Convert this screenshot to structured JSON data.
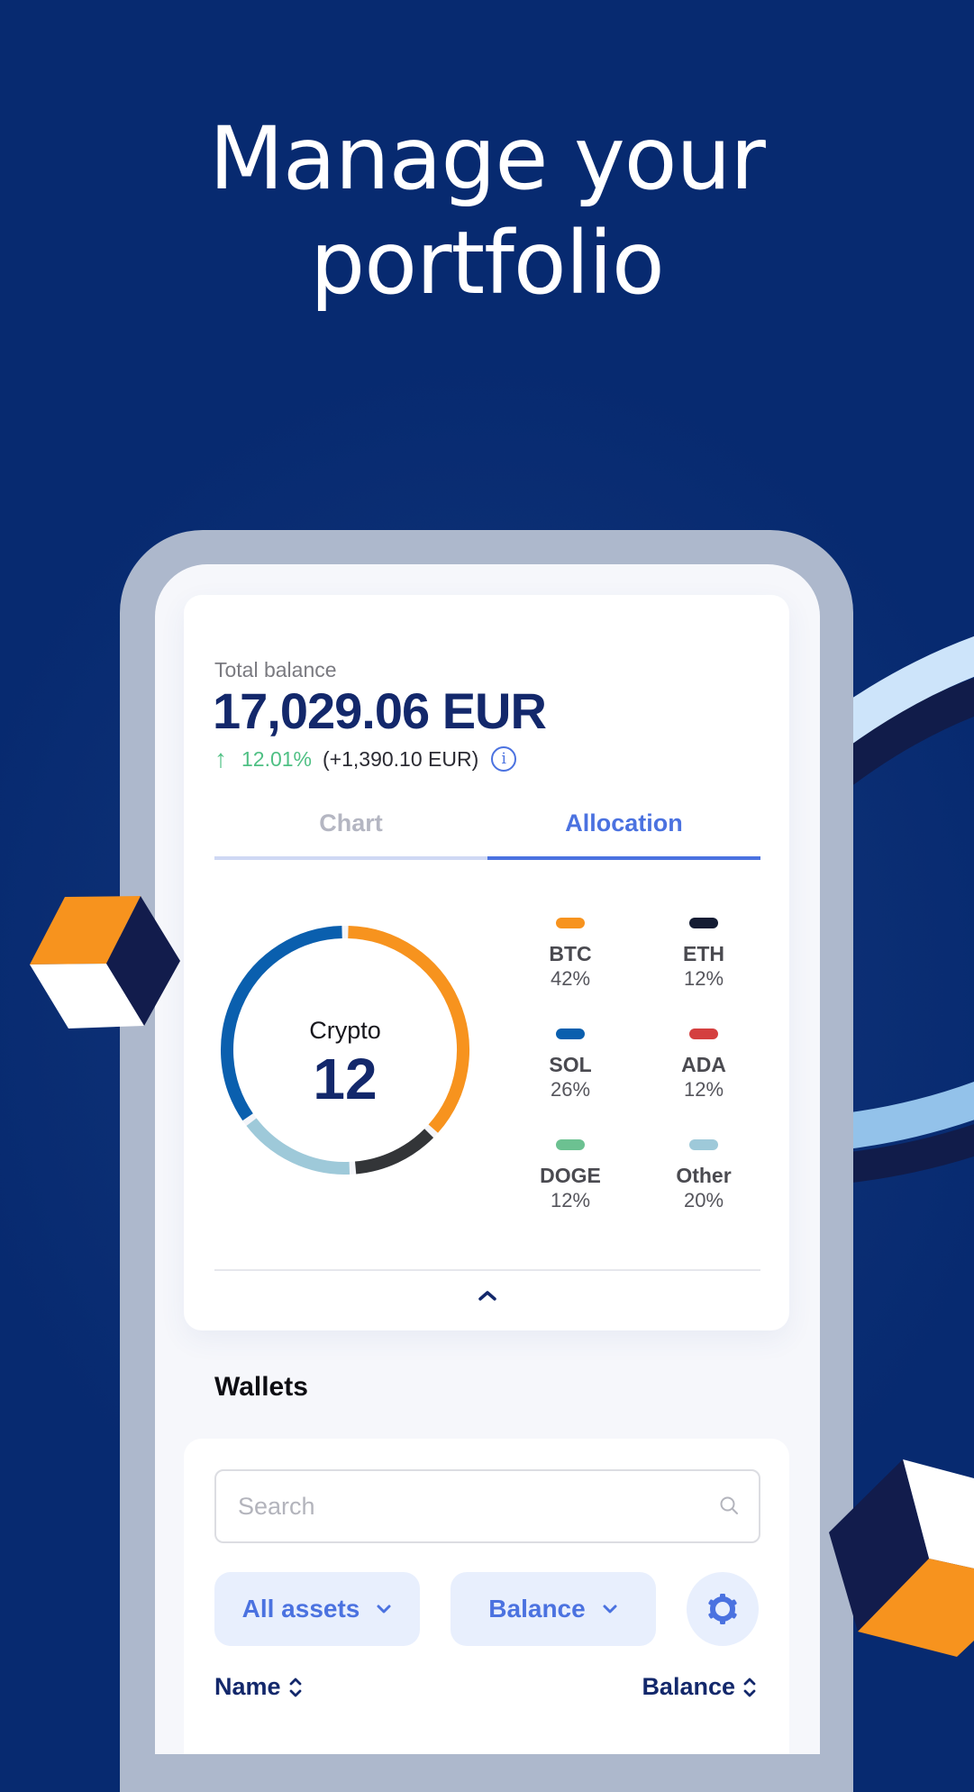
{
  "headline": {
    "line1": "Manage your",
    "line2": "portfolio"
  },
  "portfolio": {
    "total_label": "Total balance",
    "total_value": "17,029.06 EUR",
    "change_percent": "12.01%",
    "change_amount": "(+1,390.10 EUR)",
    "change_direction": "up",
    "info_icon": "info-icon"
  },
  "tabs": [
    {
      "label": "Chart",
      "active": false
    },
    {
      "label": "Allocation",
      "active": true
    }
  ],
  "chart_data": {
    "type": "pie",
    "title": "",
    "center_label": "Crypto",
    "center_value": "12",
    "categories": [
      "BTC",
      "ETH",
      "SOL",
      "ADA",
      "DOGE",
      "Other"
    ],
    "values": [
      42,
      12,
      26,
      12,
      12,
      20
    ],
    "unit": "%",
    "colors": {
      "BTC": "#f7931e",
      "ETH": "#141c33",
      "SOL": "#0a5fae",
      "ADA": "#d43f3f",
      "DOGE": "#6cc191",
      "Other": "#9ec9d9"
    },
    "legend": [
      {
        "name": "BTC",
        "value": "42%"
      },
      {
        "name": "ETH",
        "value": "12%"
      },
      {
        "name": "SOL",
        "value": "26%"
      },
      {
        "name": "ADA",
        "value": "12%"
      },
      {
        "name": "DOGE",
        "value": "12%"
      },
      {
        "name": "Other",
        "value": "20%"
      }
    ],
    "ring_segments": [
      {
        "name": "BTC",
        "color": "#f7931e",
        "fraction": 0.37
      },
      {
        "name": "ETH",
        "color": "#333538",
        "fraction": 0.12
      },
      {
        "name": "Other",
        "color": "#9ec9d9",
        "fraction": 0.16
      },
      {
        "name": "SOL",
        "color": "#0a5fae",
        "fraction": 0.35
      }
    ],
    "legend_placement": "right"
  },
  "collapse_icon": "chevron-up-icon",
  "wallets": {
    "title": "Wallets",
    "search_placeholder": "Search",
    "search_value": "",
    "filter_assets": "All assets",
    "filter_sort": "Balance",
    "settings_icon": "gear-icon",
    "columns": [
      {
        "label": "Name",
        "sortable": true
      },
      {
        "label": "Balance",
        "sortable": true
      }
    ]
  },
  "colors": {
    "brand_navy": "#13286b",
    "accent_blue": "#4b72e0",
    "positive_green": "#4fc084",
    "background": "#072a70"
  }
}
